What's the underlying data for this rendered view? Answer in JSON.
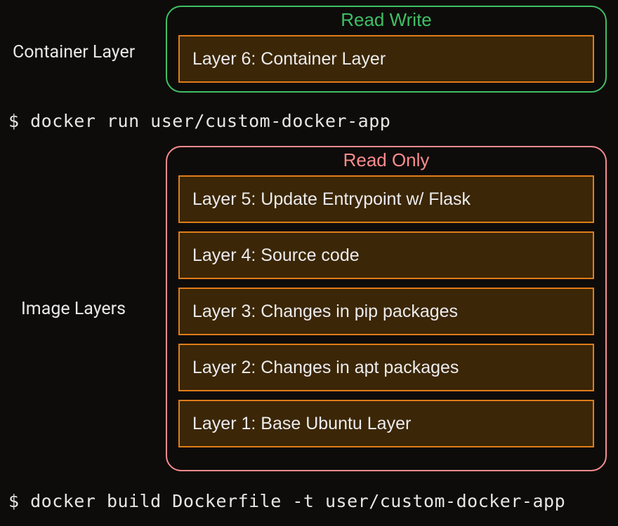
{
  "sideLabels": {
    "container": "Container Layer",
    "image": "Image Layers"
  },
  "groups": {
    "readWrite": {
      "title": "Read Write"
    },
    "readOnly": {
      "title": "Read Only"
    }
  },
  "layers": {
    "l6": "Layer 6: Container Layer",
    "l5": "Layer 5: Update Entrypoint w/ Flask",
    "l4": "Layer 4: Source code",
    "l3": "Layer 3: Changes in pip packages",
    "l2": "Layer 2: Changes in apt packages",
    "l1": "Layer 1: Base Ubuntu Layer"
  },
  "commands": {
    "run": "$ docker run user/custom-docker-app",
    "build": "$ docker build Dockerfile -t user/custom-docker-app"
  }
}
